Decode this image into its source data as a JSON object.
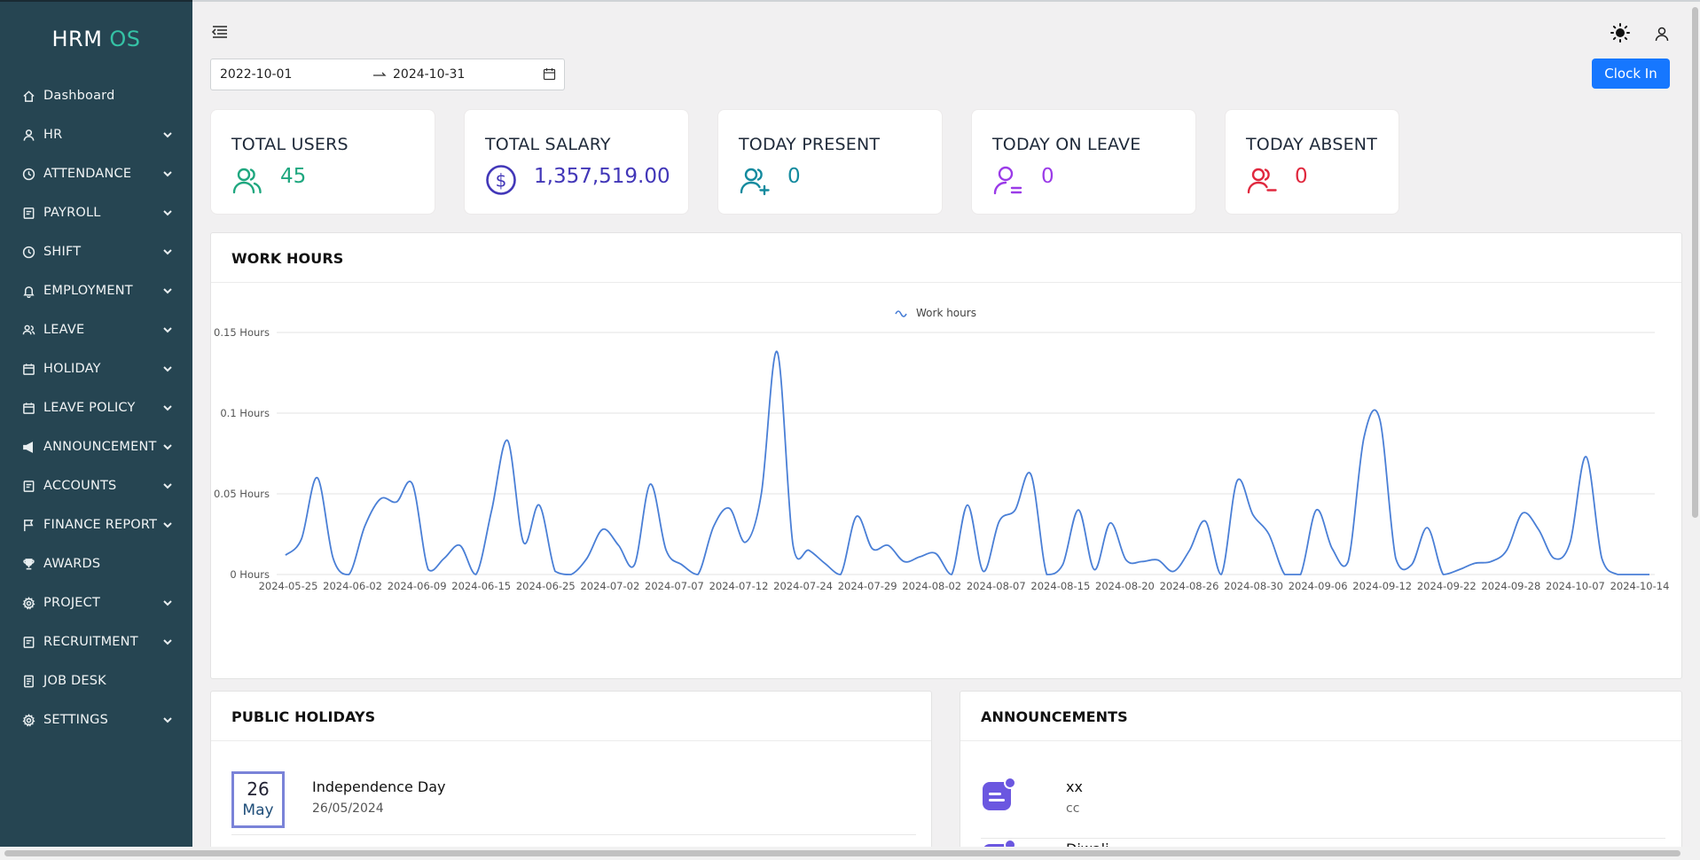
{
  "brand": {
    "name": "HRM",
    "suffix": "OS"
  },
  "sidebar": {
    "items": [
      {
        "label": "Dashboard",
        "icon": "home-icon",
        "expandable": false
      },
      {
        "label": "HR",
        "icon": "user-icon",
        "expandable": true
      },
      {
        "label": "ATTENDANCE",
        "icon": "clock-icon",
        "expandable": true
      },
      {
        "label": "PAYROLL",
        "icon": "receipt-icon",
        "expandable": true
      },
      {
        "label": "SHIFT",
        "icon": "clock-icon",
        "expandable": true
      },
      {
        "label": "EMPLOYMENT",
        "icon": "bell-icon",
        "expandable": true
      },
      {
        "label": "LEAVE",
        "icon": "users-icon",
        "expandable": true
      },
      {
        "label": "HOLIDAY",
        "icon": "calendar-icon",
        "expandable": true
      },
      {
        "label": "LEAVE POLICY",
        "icon": "calendar-icon",
        "expandable": true
      },
      {
        "label": "ANNOUNCEMENT",
        "icon": "megaphone-icon",
        "expandable": true
      },
      {
        "label": "ACCOUNTS",
        "icon": "receipt-icon",
        "expandable": true
      },
      {
        "label": "FINANCE REPORT",
        "icon": "flag-icon",
        "expandable": true
      },
      {
        "label": "AWARDS",
        "icon": "trophy-icon",
        "expandable": false
      },
      {
        "label": "PROJECT",
        "icon": "gear-icon",
        "expandable": true
      },
      {
        "label": "RECRUITMENT",
        "icon": "receipt-icon",
        "expandable": true
      },
      {
        "label": "JOB DESK",
        "icon": "document-icon",
        "expandable": false
      },
      {
        "label": "SETTINGS",
        "icon": "gear-icon",
        "expandable": true
      }
    ]
  },
  "header": {
    "date_start": "2022-10-01",
    "date_separator": "→",
    "date_end": "2024-10-31",
    "clock_in_label": "Clock In"
  },
  "stats": [
    {
      "title": "TOTAL USERS",
      "value": "45",
      "color": "#1fa77f",
      "icon": "users-icon"
    },
    {
      "title": "TOTAL SALARY",
      "value": "1,357,519.00",
      "color": "#4237b8",
      "icon": "dollar-icon"
    },
    {
      "title": "TODAY PRESENT",
      "value": "0",
      "color": "#138a9e",
      "icon": "user-add-icon"
    },
    {
      "title": "TODAY ON LEAVE",
      "value": "0",
      "color": "#9b3be8",
      "icon": "user-leave-icon"
    },
    {
      "title": "TODAY ABSENT",
      "value": "0",
      "color": "#e0283e",
      "icon": "user-remove-icon"
    }
  ],
  "work_hours": {
    "title": "WORK HOURS"
  },
  "chart_data": {
    "type": "line",
    "title": "",
    "legend": "Work hours",
    "legend_position": "top-center",
    "line_color": "#4a7fd6",
    "y_ticks": [
      "0 Hours",
      "0.05 Hours",
      "0.1 Hours",
      "0.15 Hours"
    ],
    "ylim": [
      0,
      0.15
    ],
    "x_labels": [
      "2024-05-25",
      "2024-06-02",
      "2024-06-09",
      "2024-06-15",
      "2024-06-25",
      "2024-07-02",
      "2024-07-07",
      "2024-07-12",
      "2024-07-24",
      "2024-07-29",
      "2024-08-02",
      "2024-08-07",
      "2024-08-15",
      "2024-08-20",
      "2024-08-26",
      "2024-08-30",
      "2024-09-06",
      "2024-09-12",
      "2024-09-22",
      "2024-09-28",
      "2024-10-07",
      "2024-10-14"
    ],
    "values": [
      0.012,
      0.022,
      0.06,
      0.01,
      0.0,
      0.03,
      0.047,
      0.045,
      0.056,
      0.003,
      0.01,
      0.018,
      0.0,
      0.04,
      0.083,
      0.02,
      0.043,
      0.002,
      0.0,
      0.01,
      0.028,
      0.018,
      0.006,
      0.056,
      0.015,
      0.006,
      0.0,
      0.03,
      0.041,
      0.02,
      0.05,
      0.138,
      0.018,
      0.015,
      0.007,
      0.0,
      0.036,
      0.016,
      0.018,
      0.008,
      0.011,
      0.013,
      0.0,
      0.043,
      0.002,
      0.033,
      0.04,
      0.062,
      0.0,
      0.006,
      0.04,
      0.003,
      0.032,
      0.009,
      0.008,
      0.009,
      0.002,
      0.015,
      0.033,
      0.0,
      0.058,
      0.037,
      0.025,
      0.0,
      0.0,
      0.04,
      0.016,
      0.008,
      0.085,
      0.096,
      0.01,
      0.006,
      0.029,
      0.0,
      0.003,
      0.007,
      0.008,
      0.015,
      0.038,
      0.028,
      0.01,
      0.02,
      0.073,
      0.01,
      0.0,
      0.0,
      0.0
    ]
  },
  "holidays": {
    "title": "PUBLIC HOLIDAYS",
    "items": [
      {
        "day": "26",
        "month": "May",
        "name": "Independence Day",
        "date": "26/05/2024"
      }
    ]
  },
  "announcements": {
    "title": "ANNOUNCEMENTS",
    "items": [
      {
        "title": "xx",
        "description": "cc"
      },
      {
        "title": "Diwali",
        "description": ""
      }
    ]
  }
}
